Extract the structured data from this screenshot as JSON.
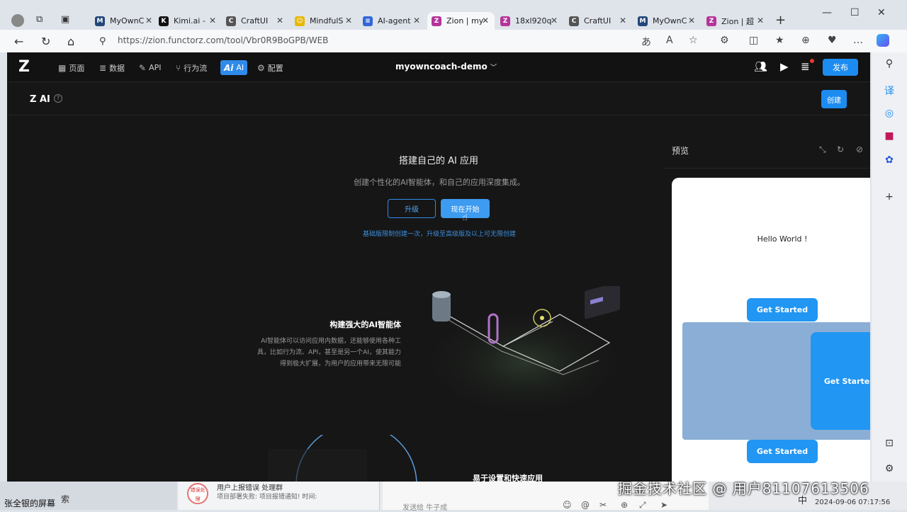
{
  "browser": {
    "tabs": [
      {
        "title": "MyOwnC",
        "color": "#22477a",
        "glyph": "M"
      },
      {
        "title": "Kimi.ai - ",
        "color": "#111111",
        "glyph": "K"
      },
      {
        "title": "CraftUI",
        "color": "#555555",
        "glyph": "C"
      },
      {
        "title": "MindfulS",
        "color": "#e6b800",
        "glyph": "☺"
      },
      {
        "title": "AI-agent",
        "color": "#3367d6",
        "glyph": "≡"
      },
      {
        "title": "Zion | my",
        "color": "#b5349a",
        "glyph": "Z"
      },
      {
        "title": "18xl920q",
        "color": "#b5349a",
        "glyph": "Z"
      },
      {
        "title": "CraftUI",
        "color": "#555555",
        "glyph": "C"
      },
      {
        "title": "MyOwnC",
        "color": "#22477a",
        "glyph": "M"
      },
      {
        "title": "Zion | 超",
        "color": "#b5349a",
        "glyph": "Z"
      }
    ],
    "url": "https://zion.functorz.com/tool/Vbr0R9BoGPB/WEB"
  },
  "topnav": {
    "items": [
      "页面",
      "数据",
      "API",
      "行为流",
      "AI",
      "配置"
    ],
    "project": "myowncoach-demo",
    "publish": "发布"
  },
  "subhead": {
    "title": "Z AI",
    "create": "创建"
  },
  "hero": {
    "title": "搭建自己的 AI 应用",
    "subtitle": "创建个性化的AI智能体，和自己的应用深度集成。",
    "upgrade": "升级",
    "start": "现在开始",
    "note": "基础版限制创建一次，升级至高级版及以上可无限创建"
  },
  "feature": {
    "title": "构建强大的AI智能体",
    "desc1": "AI智能体可以访问应用内数据，还能够使用各种工",
    "desc2": "具，比如行为流、API，甚至是另一个AI，使其能力",
    "desc3": "得到极大扩展，为用户的应用带来无限可能",
    "second_title": "易于设置和快速应用"
  },
  "preview": {
    "title": "预览",
    "hello": "Hello World !",
    "button1": "Get Started",
    "button2": "Get Started",
    "button3": "Get Started"
  },
  "taskbar": {
    "left": "张全银的屏幕",
    "search": "索",
    "msg_title": "用户上报错误 处理群",
    "msg_sub": "项目部署失败: 项目报错通知! 时间:",
    "badge": "错误处理",
    "chat_placeholder": "发送给 牛子成",
    "ime": "中",
    "datetime": "2024-09-06 07:17:56"
  },
  "watermark": "掘金技术社区 @ 用户81107613506"
}
